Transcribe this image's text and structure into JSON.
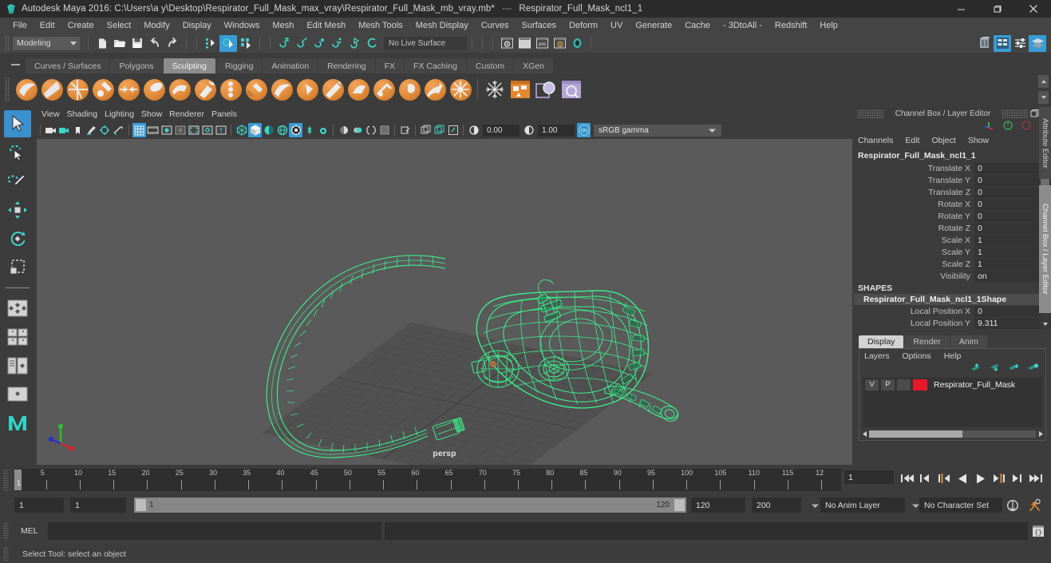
{
  "window": {
    "app_title": "Autodesk Maya 2016: C:\\Users\\a y\\Desktop\\Respirator_Full_Mask_max_vray\\Respirator_Full_Mask_mb_vray.mb*",
    "separator": "---",
    "sub_title": "Respirator_Full_Mask_ncl1_1",
    "logo_icon": "maya-logo-icon",
    "minimize_icon": "minimize-icon",
    "maximize_icon": "maximize-icon",
    "close_icon": "close-icon"
  },
  "menubar": {
    "items": [
      "File",
      "Edit",
      "Create",
      "Select",
      "Modify",
      "Display",
      "Windows",
      "Mesh",
      "Edit Mesh",
      "Mesh Tools",
      "Mesh Display",
      "Curves",
      "Surfaces",
      "Deform",
      "UV",
      "Generate",
      "Cache",
      "- 3DtoAll -",
      "Redshift",
      "Help"
    ]
  },
  "statusline": {
    "mode": "Modeling",
    "live_surface": "No Live Surface",
    "icons": [
      "new-scene-icon",
      "open-scene-icon",
      "save-scene-icon",
      "undo-icon",
      "redo-icon",
      "select-by-hierarchy-icon",
      "select-by-object-icon",
      "select-by-component-icon",
      "snap-grid-icon",
      "snap-curve-icon",
      "snap-point-icon",
      "snap-projected-icon",
      "snap-view-plane-icon",
      "make-live-icon",
      "render-current-frame-icon",
      "render-sequence-icon",
      "ipr-render-icon",
      "render-settings-icon",
      "hypershade-icon"
    ],
    "right_icons": [
      "show-hide-editors-icon",
      "attribute-editor-icon",
      "tool-settings-icon",
      "channel-box-icon"
    ]
  },
  "shelf": {
    "tabs": [
      "Curves / Surfaces",
      "Polygons",
      "Sculpting",
      "Rigging",
      "Animation",
      "Rendering",
      "FX",
      "FX Caching",
      "Custom",
      "XGen"
    ],
    "active_tab": "Sculpting",
    "hamburger_icon": "shelf-menu-icon",
    "tools": [
      "sculpt-icon",
      "smooth-icon",
      "relax-icon",
      "grab-icon",
      "pinch-icon",
      "flatten-icon",
      "foamy-icon",
      "spray-icon",
      "repeat-icon",
      "imprint-icon",
      "wax-icon",
      "scrape-icon",
      "fill-icon",
      "knife-icon",
      "smear-icon",
      "bulge-icon",
      "amplify-icon",
      "freeze-icon",
      "convert-icon",
      "sculpt-tool-settings-icon",
      "sculpt-layer-icon",
      "sculpt-mirror-icon"
    ],
    "scroll_up_icon": "shelf-scroll-up-icon",
    "scroll_down_icon": "shelf-scroll-down-icon"
  },
  "toolbox": {
    "tools": [
      {
        "name": "select-tool",
        "icon": "arrow-cursor-icon",
        "active": true
      },
      {
        "name": "lasso-select-tool",
        "icon": "lasso-icon",
        "active": false
      },
      {
        "name": "paint-select-tool",
        "icon": "paint-brush-icon",
        "active": false
      },
      {
        "name": "move-tool",
        "icon": "move-arrows-icon",
        "active": false
      },
      {
        "name": "rotate-tool",
        "icon": "rotate-ring-icon",
        "active": false
      },
      {
        "name": "scale-tool",
        "icon": "scale-box-icon",
        "active": false
      },
      {
        "name": "last-tool",
        "icon": "last-tool-icon",
        "active": false
      },
      {
        "name": "four-view-layout",
        "icon": "four-view-icon",
        "active": false
      },
      {
        "name": "single-perspective-layout",
        "icon": "single-pane-icon",
        "active": false
      },
      {
        "name": "outliner-persp-layout",
        "icon": "outliner-persp-icon",
        "active": false
      },
      {
        "name": "persp-graph-layout",
        "icon": "persp-graph-icon",
        "active": false
      },
      {
        "name": "maya-logo",
        "icon": "maya-logo-icon",
        "active": false
      }
    ]
  },
  "viewport": {
    "menus": [
      "View",
      "Shading",
      "Lighting",
      "Show",
      "Renderer",
      "Panels"
    ],
    "camera_label": "persp",
    "gamma": "sRGB gamma",
    "exposure": "0.00",
    "gamma_value": "1.00",
    "color_mgmt_toggle": "on",
    "toolbar_icons": [
      "select-camera-icon",
      "lock-camera-icon",
      "bookmark-icon",
      "image-plane-icon",
      "2d-pan-zoom-icon",
      "oriented-bbox-icon",
      "grid-icon",
      "film-gate-icon",
      "resolution-gate-icon",
      "gate-mask-icon",
      "film-origin-icon",
      "safe-action-icon",
      "safe-title-icon",
      "wireframe-icon",
      "smooth-shade-icon",
      "flat-shade-icon",
      "shaded-wireframe-icon",
      "textured-icon",
      "lights-icon",
      "shadows-icon",
      "screen-space-ao-icon",
      "motion-blur-icon",
      "multisample-icon",
      "isolate-select-icon",
      "xray-icon",
      "xray-joints-icon",
      "xray-active-icon",
      "exposure-icon",
      "gamma-icon",
      "color-management-icon"
    ]
  },
  "channelbox": {
    "panel_title": "Channel Box / Layer Editor",
    "undock_icon": "undock-icon",
    "close_icon": "close-icon",
    "menus": [
      "Channels",
      "Edit",
      "Object",
      "Show"
    ],
    "object_name": "Respirator_Full_Mask_ncl1_1",
    "attributes": [
      {
        "label": "Translate X",
        "value": "0"
      },
      {
        "label": "Translate Y",
        "value": "0"
      },
      {
        "label": "Translate Z",
        "value": "0"
      },
      {
        "label": "Rotate X",
        "value": "0"
      },
      {
        "label": "Rotate Y",
        "value": "0"
      },
      {
        "label": "Rotate Z",
        "value": "0"
      },
      {
        "label": "Scale X",
        "value": "1"
      },
      {
        "label": "Scale Y",
        "value": "1"
      },
      {
        "label": "Scale Z",
        "value": "1"
      },
      {
        "label": "Visibility",
        "value": "on"
      }
    ],
    "shapes_header": "SHAPES",
    "shape_name": "Respirator_Full_Mask_ncl1_1Shape",
    "shape_attributes": [
      {
        "label": "Local Position X",
        "value": "0"
      },
      {
        "label": "Local Position Y",
        "value": "9.311"
      }
    ],
    "scroll_up_icon": "scroll-up-icon",
    "scroll_down_icon": "scroll-down-icon",
    "vertical_tabs": [
      "Attribute Editor",
      "Channel Box / Layer Editor"
    ],
    "active_vertical_tab": "Channel Box / Layer Editor"
  },
  "layer_editor": {
    "tabs": [
      "Display",
      "Render",
      "Anim"
    ],
    "active_tab": "Display",
    "menus": [
      "Layers",
      "Options",
      "Help"
    ],
    "toolbar_icons": [
      "move-layer-up-icon",
      "move-layer-down-icon",
      "new-layer-icon",
      "new-layer-from-selected-icon"
    ],
    "layers": [
      {
        "visibility": "V",
        "playback": "P",
        "type": "",
        "color": "#e8172a",
        "name": "Respirator_Full_Mask"
      }
    ],
    "scroll_left_icon": "scroll-left-icon",
    "scroll_right_icon": "scroll-right-icon"
  },
  "timeline": {
    "ticks": [
      "5",
      "10",
      "15",
      "20",
      "25",
      "30",
      "35",
      "40",
      "45",
      "50",
      "55",
      "60",
      "65",
      "70",
      "75",
      "80",
      "85",
      "90",
      "95",
      "100",
      "105",
      "110",
      "115",
      "12"
    ],
    "current_frame_marker": "1",
    "current_frame_field": "1",
    "playback_icons": [
      "go-to-start-icon",
      "step-back-key-icon",
      "step-back-frame-icon",
      "play-backwards-icon",
      "play-forwards-icon",
      "step-forward-frame-icon",
      "step-forward-key-icon",
      "go-to-end-icon"
    ]
  },
  "range": {
    "anim_start": "1",
    "range_start": "1",
    "slider_low_label": "1",
    "slider_high_label": "120",
    "range_end": "120",
    "anim_end": "200",
    "anim_layer": "No Anim Layer",
    "character_set": "No Character Set",
    "auto_keyframe_icon": "auto-keyframe-icon",
    "animation_preferences_icon": "animation-preferences-icon"
  },
  "mel": {
    "label": "MEL",
    "input_value": "",
    "output_value": "",
    "script_editor_icon": "script-editor-icon"
  },
  "helpline": {
    "text": "Select Tool: select an object"
  },
  "colors": {
    "accent_blue": "#3a9cd6",
    "wireframe_green": "#3cf08c",
    "layer_red": "#e8172a",
    "background": "#3c3c3c",
    "viewport_bg": "#5a5a5a",
    "orange": "#e08a38"
  }
}
